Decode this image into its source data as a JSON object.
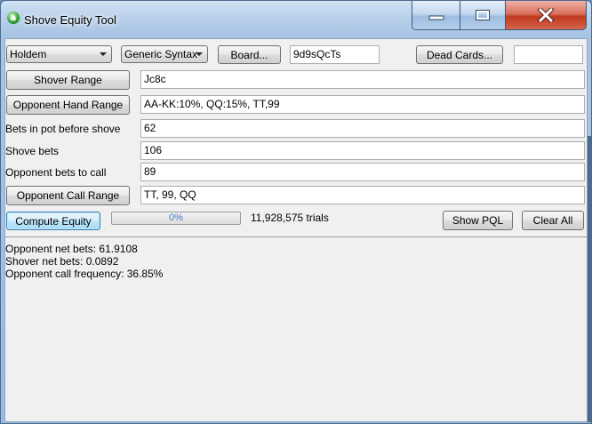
{
  "window": {
    "title": "Shove Equity Tool"
  },
  "toolbar": {
    "game_select": "Holdem",
    "syntax_select": "Generic Syntax",
    "board_button": "Board...",
    "board_value": "9d9sQcTs",
    "dead_cards_button": "Dead Cards...",
    "dead_cards_value": ""
  },
  "form": {
    "shover_range_button": "Shover Range",
    "shover_range_value": "Jc8c",
    "opponent_hand_range_button": "Opponent Hand Range",
    "opponent_hand_range_value": "AA-KK:10%, QQ:15%, TT,99",
    "bets_in_pot_label": "Bets in pot before shove",
    "bets_in_pot_value": "62",
    "shove_bets_label": "Shove bets",
    "shove_bets_value": "106",
    "opponent_bets_to_call_label": "Opponent bets to call",
    "opponent_bets_to_call_value": "89",
    "opponent_call_range_button": "Opponent Call Range",
    "opponent_call_range_value": "TT, 99, QQ"
  },
  "actions": {
    "compute_button": "Compute Equity",
    "progress_text": "0%",
    "progress_fraction": 0,
    "trials_text": "11,928,575 trials",
    "show_pql_button": "Show PQL",
    "clear_all_button": "Clear All"
  },
  "results": {
    "line1": "Opponent net bets: 61.9108",
    "line2": "Shover net bets: 0.0892",
    "line3": "Opponent call frequency: 36.85%"
  }
}
